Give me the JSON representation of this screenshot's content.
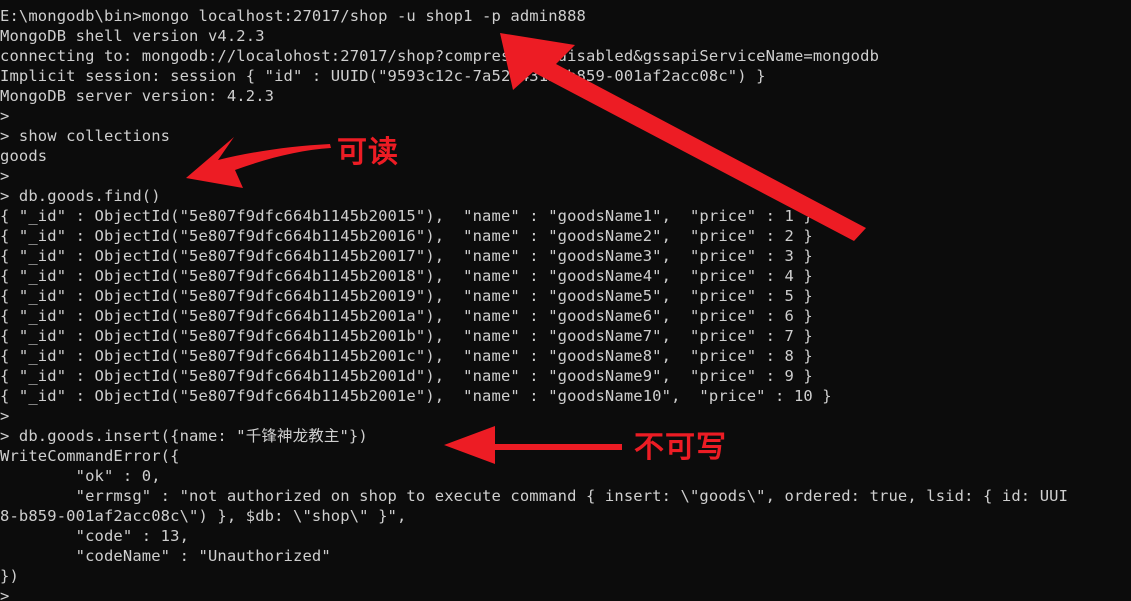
{
  "terminal": {
    "prompt_symbol": ">",
    "background_color": "#0c0c0c",
    "text_color": "#cfcfcf",
    "lines": [
      "E:\\mongodb\\bin>mongo localhost:27017/shop -u shop1 -p admin888",
      "MongoDB shell version v4.2.3",
      "connecting to: mongodb://localohost:27017/shop?compressors=disabled&gssapiServiceName=mongodb",
      "Implicit session: session { \"id\" : UUID(\"9593c12c-7a52-4312-b859-001af2acc08c\") }",
      "MongoDB server version: 4.2.3",
      ">",
      "> show collections",
      "goods",
      ">",
      "> db.goods.find()",
      "{ \"_id\" : ObjectId(\"5e807f9dfc664b1145b20015\"),  \"name\" : \"goodsName1\",  \"price\" : 1 }",
      "{ \"_id\" : ObjectId(\"5e807f9dfc664b1145b20016\"),  \"name\" : \"goodsName2\",  \"price\" : 2 }",
      "{ \"_id\" : ObjectId(\"5e807f9dfc664b1145b20017\"),  \"name\" : \"goodsName3\",  \"price\" : 3 }",
      "{ \"_id\" : ObjectId(\"5e807f9dfc664b1145b20018\"),  \"name\" : \"goodsName4\",  \"price\" : 4 }",
      "{ \"_id\" : ObjectId(\"5e807f9dfc664b1145b20019\"),  \"name\" : \"goodsName5\",  \"price\" : 5 }",
      "{ \"_id\" : ObjectId(\"5e807f9dfc664b1145b2001a\"),  \"name\" : \"goodsName6\",  \"price\" : 6 }",
      "{ \"_id\" : ObjectId(\"5e807f9dfc664b1145b2001b\"),  \"name\" : \"goodsName7\",  \"price\" : 7 }",
      "{ \"_id\" : ObjectId(\"5e807f9dfc664b1145b2001c\"),  \"name\" : \"goodsName8\",  \"price\" : 8 }",
      "{ \"_id\" : ObjectId(\"5e807f9dfc664b1145b2001d\"),  \"name\" : \"goodsName9\",  \"price\" : 9 }",
      "{ \"_id\" : ObjectId(\"5e807f9dfc664b1145b2001e\"),  \"name\" : \"goodsName10\",  \"price\" : 10 }",
      ">",
      "> db.goods.insert({name: \"千锋神龙教主\"})",
      "WriteCommandError({",
      "        \"ok\" : 0,",
      "        \"errmsg\" : \"not authorized on shop to execute command { insert: \\\"goods\\\", ordered: true, lsid: { id: UUI",
      "8-b859-001af2acc08c\\\") }, $db: \\\"shop\\\" }\",",
      "        \"code\" : 13,",
      "        \"codeName\" : \"Unauthorized\"",
      "})",
      ">"
    ]
  },
  "annotations": {
    "color": "#ed1c24",
    "outline_color": "#ffffff",
    "readable": {
      "label": "可读",
      "target": "goods collection listing"
    },
    "not_writable": {
      "label": "不可写",
      "target": "db.goods.insert write attempt"
    },
    "login_arrow": {
      "target": "mongo login command with -u shop1 -p admin888"
    }
  }
}
